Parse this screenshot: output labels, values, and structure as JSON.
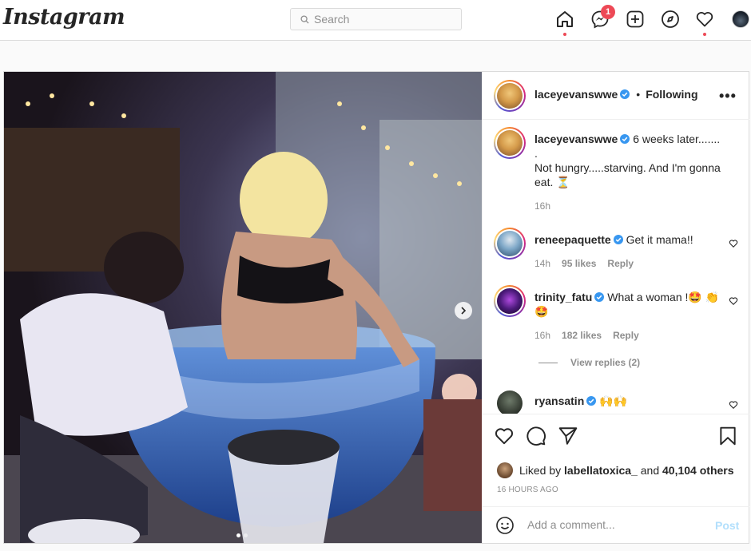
{
  "app": {
    "logo_text": "Instagram"
  },
  "nav": {
    "search_placeholder": "Search",
    "messages_badge": "1",
    "icons": [
      "home-icon",
      "messenger-icon",
      "new-post-icon",
      "explore-icon",
      "activity-heart-icon",
      "profile-avatar"
    ]
  },
  "post": {
    "author": "laceyevanswwe",
    "follow_separator": "•",
    "follow_status": "Following",
    "more_label": "•••",
    "caption": {
      "username": "laceyevanswwe",
      "line1": "6 weeks later.......",
      "line2": ".",
      "line3": "Not hungry.....starving. And I'm gonna eat. ⏳",
      "time": "16h"
    },
    "comments": [
      {
        "username": "reneepaquette",
        "text": "Get it mama!!",
        "time": "14h",
        "likes": "95 likes",
        "reply": "Reply"
      },
      {
        "username": "trinity_fatu",
        "text": "What a woman !🤩 👏🤩",
        "time": "16h",
        "likes": "182 likes",
        "reply": "Reply",
        "view_replies": "View replies (2)"
      },
      {
        "username": "ryansatin",
        "text": "🙌🙌"
      }
    ],
    "liked_by_prefix": "Liked by",
    "liked_by_user": "labellatoxica_",
    "liked_by_and": "and",
    "liked_by_others": "40,104 others",
    "time_ago": "16 HOURS AGO",
    "add_comment_placeholder": "Add a comment...",
    "post_button": "Post",
    "carousel": {
      "slides": 2,
      "active": 1
    }
  },
  "colors": {
    "badge": "#ed4956",
    "verified": "#3897f0",
    "post_disabled": "#b2dffc",
    "muted": "#8e8e8e"
  }
}
